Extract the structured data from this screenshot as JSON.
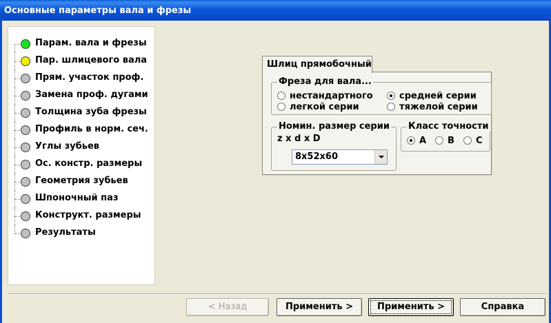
{
  "window": {
    "title": "Основные параметры вала и фрезы"
  },
  "tree": {
    "items": [
      {
        "label": "Парам. вала и фрезы",
        "status": "#1ee01e"
      },
      {
        "label": "Пар. шлицевого вала",
        "status": "#f0f000"
      },
      {
        "label": "Прям. участок проф.",
        "status": "#c0c0c0"
      },
      {
        "label": "Замена проф. дугами",
        "status": "#c0c0c0"
      },
      {
        "label": "Толщина зуба фрезы",
        "status": "#c0c0c0"
      },
      {
        "label": "Профиль в норм. сеч.",
        "status": "#c0c0c0"
      },
      {
        "label": "Углы зубьев",
        "status": "#c0c0c0"
      },
      {
        "label": "Ос. констр. размеры",
        "status": "#c0c0c0"
      },
      {
        "label": "Геометрия зубьев",
        "status": "#c0c0c0"
      },
      {
        "label": "Шпоночный паз",
        "status": "#c0c0c0"
      },
      {
        "label": "Конструкт. размеры",
        "status": "#c0c0c0"
      },
      {
        "label": "Результаты",
        "status": "#c0c0c0"
      }
    ]
  },
  "tab": {
    "label": "Шлиц прямобочный"
  },
  "cutter_group": {
    "title": "Фреза для вала...",
    "options": {
      "nonstandard": "нестандартного",
      "medium": "средней серии",
      "light": "легкой серии",
      "heavy": "тяжелой серии"
    },
    "selected": "medium"
  },
  "size_group": {
    "title": "Номин. размер серии",
    "subtitle": "z x d x D",
    "selected_value": "8x52x60"
  },
  "accuracy_group": {
    "title": "Класс точности",
    "options": {
      "a": "A",
      "b": "B",
      "c": "C"
    },
    "selected": "a"
  },
  "buttons": {
    "back": "< Назад",
    "apply1": "Применить >",
    "apply2": "Применить >",
    "help": "Справка"
  }
}
